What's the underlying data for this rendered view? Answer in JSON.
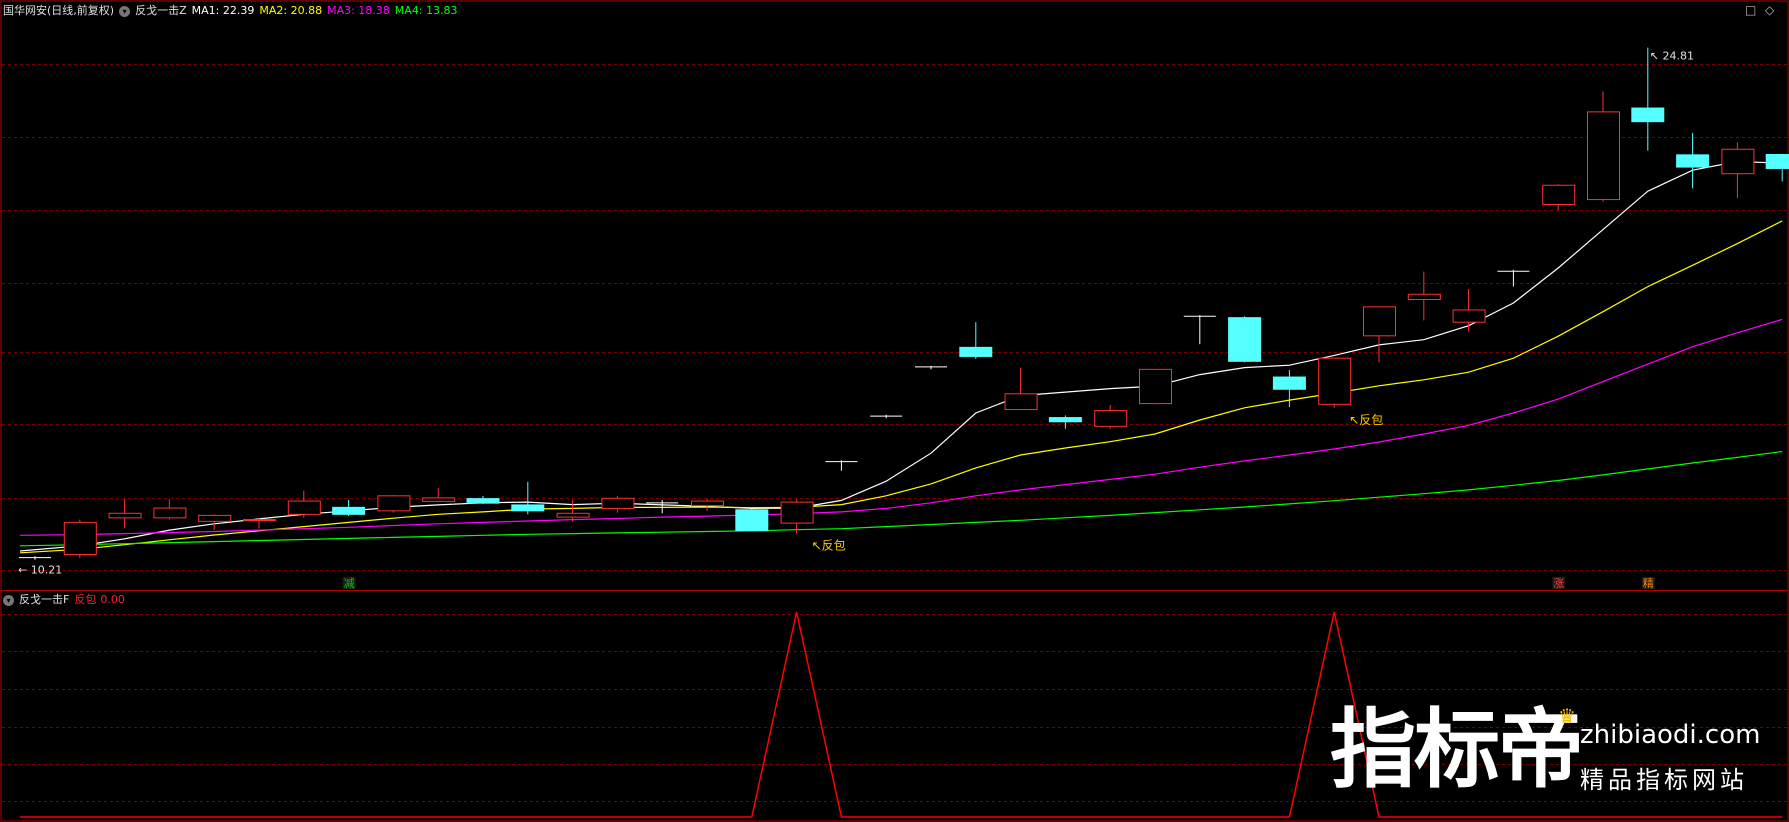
{
  "header": {
    "stock_name": "国华网安(日线,前复权)",
    "indicator_name": "反戈一击Z",
    "ma": [
      {
        "label": "MA1: 22.39",
        "color": "#ffffff"
      },
      {
        "label": "MA2: 20.88",
        "color": "#ffff00"
      },
      {
        "label": "MA3: 18.38",
        "color": "#ff00ff"
      },
      {
        "label": "MA4: 13.83",
        "color": "#00ff00"
      }
    ]
  },
  "sub_header": {
    "indicator_name": "反戈一击F",
    "series_label": "反包",
    "series_value": "0.00"
  },
  "corner": {
    "restore": "□",
    "diamond": "◇"
  },
  "watermark": {
    "cn": "指标帝",
    "en": "zhibiaodi.com",
    "sub": "精品指标网站"
  },
  "chart_data": {
    "type": "candlestick",
    "ylim": [
      10,
      25.6
    ],
    "high_label": "24.81",
    "low_label": "10.21",
    "candles": [
      {
        "o": 10.21,
        "h": 10.25,
        "l": 10.15,
        "c": 10.21,
        "flat": true
      },
      {
        "o": 10.3,
        "h": 11.3,
        "l": 10.2,
        "c": 11.22
      },
      {
        "o": 11.35,
        "h": 11.88,
        "l": 11.05,
        "c": 11.48
      },
      {
        "o": 11.35,
        "h": 11.88,
        "l": 11.3,
        "c": 11.63
      },
      {
        "o": 11.25,
        "h": 11.45,
        "l": 11.0,
        "c": 11.42
      },
      {
        "o": 11.28,
        "h": 11.35,
        "l": 11.05,
        "c": 11.3
      },
      {
        "o": 11.45,
        "h": 12.13,
        "l": 11.35,
        "c": 11.83
      },
      {
        "o": 11.65,
        "h": 11.87,
        "l": 11.4,
        "c": 11.45
      },
      {
        "o": 11.55,
        "h": 12.0,
        "l": 11.5,
        "c": 11.98
      },
      {
        "o": 11.82,
        "h": 12.2,
        "l": 11.8,
        "c": 11.92
      },
      {
        "o": 11.9,
        "h": 11.98,
        "l": 11.75,
        "c": 11.77
      },
      {
        "o": 11.72,
        "h": 12.38,
        "l": 11.45,
        "c": 11.55
      },
      {
        "o": 11.37,
        "h": 11.86,
        "l": 11.25,
        "c": 11.48
      },
      {
        "o": 11.62,
        "h": 11.98,
        "l": 11.5,
        "c": 11.91
      },
      {
        "o": 11.78,
        "h": 11.86,
        "l": 11.48,
        "c": 11.78,
        "flat": true
      },
      {
        "o": 11.7,
        "h": 11.9,
        "l": 11.55,
        "c": 11.83
      },
      {
        "o": 11.58,
        "h": 11.6,
        "l": 10.98,
        "c": 10.98
      },
      {
        "o": 11.2,
        "h": 11.88,
        "l": 10.9,
        "c": 11.8
      },
      {
        "o": 12.96,
        "h": 13.0,
        "l": 12.7,
        "c": 12.96,
        "flat": true
      },
      {
        "o": 14.26,
        "h": 14.3,
        "l": 14.2,
        "c": 14.26,
        "flat": true
      },
      {
        "o": 15.67,
        "h": 15.7,
        "l": 15.6,
        "c": 15.67,
        "flat": true
      },
      {
        "o": 16.23,
        "h": 16.95,
        "l": 15.9,
        "c": 15.97
      },
      {
        "o": 14.45,
        "h": 15.65,
        "l": 14.45,
        "c": 14.9
      },
      {
        "o": 14.22,
        "h": 14.28,
        "l": 13.9,
        "c": 14.1
      },
      {
        "o": 13.97,
        "h": 14.58,
        "l": 13.9,
        "c": 14.42
      },
      {
        "o": 14.62,
        "h": 15.6,
        "l": 14.6,
        "c": 15.6
      },
      {
        "o": 17.12,
        "h": 17.15,
        "l": 16.32,
        "c": 17.12,
        "flat": true
      },
      {
        "o": 17.08,
        "h": 17.12,
        "l": 15.8,
        "c": 15.83
      },
      {
        "o": 15.38,
        "h": 15.58,
        "l": 14.52,
        "c": 15.03
      },
      {
        "o": 14.6,
        "h": 15.92,
        "l": 14.5,
        "c": 15.92
      },
      {
        "o": 16.56,
        "h": 17.39,
        "l": 15.8,
        "c": 17.39
      },
      {
        "o": 17.6,
        "h": 18.4,
        "l": 17.0,
        "c": 17.75
      },
      {
        "o": 16.95,
        "h": 17.9,
        "l": 16.68,
        "c": 17.3
      },
      {
        "o": 18.41,
        "h": 18.45,
        "l": 17.97,
        "c": 18.41,
        "flat": true
      },
      {
        "o": 20.32,
        "h": 20.9,
        "l": 20.16,
        "c": 20.87
      },
      {
        "o": 20.46,
        "h": 23.56,
        "l": 20.4,
        "c": 22.97
      },
      {
        "o": 23.08,
        "h": 24.81,
        "l": 21.86,
        "c": 22.69
      },
      {
        "o": 21.74,
        "h": 22.37,
        "l": 20.78,
        "c": 21.39
      },
      {
        "o": 21.2,
        "h": 22.1,
        "l": 20.5,
        "c": 21.9
      },
      {
        "o": 21.75,
        "h": 21.77,
        "l": 20.98,
        "c": 21.35
      }
    ],
    "ma_series": [
      {
        "name": "MA1",
        "color": "#ffffff",
        "values": [
          10.4,
          10.55,
          10.75,
          11.0,
          11.18,
          11.32,
          11.45,
          11.55,
          11.65,
          11.72,
          11.78,
          11.8,
          11.73,
          11.77,
          11.72,
          11.68,
          11.62,
          11.63,
          11.85,
          12.4,
          13.2,
          14.35,
          14.85,
          14.95,
          15.05,
          15.12,
          15.45,
          15.65,
          15.72,
          16.0,
          16.3,
          16.45,
          16.85,
          17.5,
          18.5,
          19.6,
          20.7,
          21.3,
          21.55,
          21.5
        ]
      },
      {
        "name": "MA2",
        "color": "#ffff00",
        "values": [
          10.35,
          10.45,
          10.58,
          10.72,
          10.86,
          10.98,
          11.1,
          11.22,
          11.34,
          11.45,
          11.52,
          11.6,
          11.62,
          11.65,
          11.65,
          11.66,
          11.64,
          11.65,
          11.73,
          11.98,
          12.32,
          12.78,
          13.15,
          13.35,
          13.53,
          13.75,
          14.15,
          14.5,
          14.72,
          14.92,
          15.13,
          15.3,
          15.52,
          15.92,
          16.55,
          17.25,
          17.97,
          18.58,
          19.2,
          19.85
        ]
      },
      {
        "name": "MA3",
        "color": "#ff00ff",
        "values": [
          10.85,
          10.87,
          10.9,
          10.93,
          10.96,
          11.0,
          11.04,
          11.08,
          11.13,
          11.18,
          11.22,
          11.26,
          11.3,
          11.33,
          11.37,
          11.4,
          11.43,
          11.47,
          11.52,
          11.62,
          11.78,
          11.98,
          12.15,
          12.3,
          12.45,
          12.6,
          12.8,
          12.98,
          13.15,
          13.32,
          13.52,
          13.75,
          14.0,
          14.35,
          14.75,
          15.25,
          15.75,
          16.25,
          16.65,
          17.03
        ]
      },
      {
        "name": "MA4",
        "color": "#00ff00",
        "values": [
          10.55,
          10.58,
          10.61,
          10.64,
          10.67,
          10.7,
          10.73,
          10.76,
          10.79,
          10.82,
          10.85,
          10.88,
          10.9,
          10.92,
          10.94,
          10.96,
          10.98,
          11.01,
          11.04,
          11.1,
          11.16,
          11.22,
          11.28,
          11.35,
          11.42,
          11.5,
          11.58,
          11.66,
          11.75,
          11.84,
          11.94,
          12.04,
          12.15,
          12.28,
          12.42,
          12.58,
          12.75,
          12.92,
          13.08,
          13.25
        ]
      }
    ],
    "annotations": [
      {
        "index": 17,
        "price": 10.9,
        "text": "↖反包",
        "color": "#ffcc00"
      },
      {
        "index": 29,
        "price": 14.5,
        "text": "↖反包",
        "color": "#ffcc00"
      }
    ],
    "markers": [
      {
        "index": 7,
        "text": "减",
        "color": "#00cc00"
      },
      {
        "index": 34,
        "text": "涨",
        "color": "#ff4040"
      },
      {
        "index": 36,
        "text": "精",
        "color": "#ff8800"
      }
    ],
    "sub": {
      "ylim": [
        0,
        1
      ],
      "series_name": "反包",
      "color": "#ff0000",
      "values": [
        0,
        0,
        0,
        0,
        0,
        0,
        0,
        0,
        0,
        0,
        0,
        0,
        0,
        0,
        0,
        0,
        0,
        1,
        0,
        0,
        0,
        0,
        0,
        0,
        0,
        0,
        0,
        0,
        0,
        1,
        0,
        0,
        0,
        0,
        0,
        0,
        0,
        0,
        0,
        0
      ]
    }
  }
}
